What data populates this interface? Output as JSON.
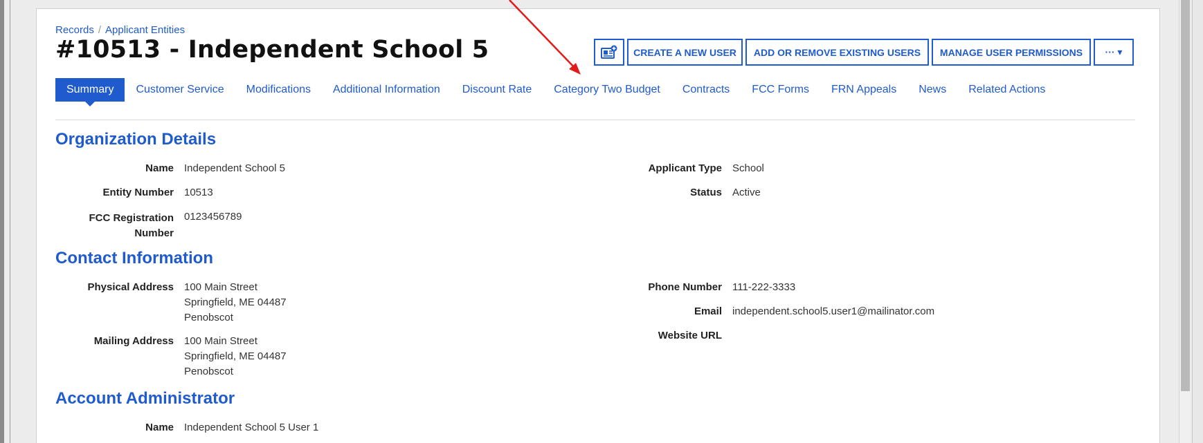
{
  "breadcrumb": {
    "root": "Records",
    "current": "Applicant Entities"
  },
  "page_title": "#10513 - Independent School 5",
  "toolbar": {
    "icon_button": "contact-card-add-icon",
    "create_user": "CREATE A NEW USER",
    "add_remove_users": "ADD OR REMOVE EXISTING USERS",
    "manage_permissions": "MANAGE USER PERMISSIONS",
    "more": "··· ▾"
  },
  "tabs": [
    {
      "label": "Summary",
      "active": true
    },
    {
      "label": "Customer Service"
    },
    {
      "label": "Modifications"
    },
    {
      "label": "Additional Information"
    },
    {
      "label": "Discount Rate"
    },
    {
      "label": "Category Two Budget"
    },
    {
      "label": "Contracts"
    },
    {
      "label": "FCC Forms"
    },
    {
      "label": "FRN Appeals"
    },
    {
      "label": "News"
    },
    {
      "label": "Related Actions"
    }
  ],
  "organization": {
    "title": "Organization Details",
    "name_label": "Name",
    "name": "Independent School 5",
    "entity_label": "Entity Number",
    "entity": "10513",
    "fcc_label_1": "FCC Registration",
    "fcc_label_2": "Number",
    "fcc": "0123456789",
    "type_label": "Applicant Type",
    "type": "School",
    "status_label": "Status",
    "status": "Active"
  },
  "contact": {
    "title": "Contact Information",
    "physical_label": "Physical Address",
    "physical": [
      "100 Main Street",
      "Springfield, ME 04487",
      "Penobscot"
    ],
    "mailing_label": "Mailing Address",
    "mailing": [
      "100 Main Street",
      "Springfield, ME 04487",
      "Penobscot"
    ],
    "phone_label": "Phone Number",
    "phone": "111-222-3333",
    "email_label": "Email",
    "email": "independent.school5.user1@mailinator.com",
    "website_label": "Website URL"
  },
  "admin": {
    "title": "Account Administrator",
    "name_label": "Name",
    "name": "Independent School 5 User 1"
  },
  "colors": {
    "accent": "#1f5bcc",
    "annotation_arrow": "#e11a1a"
  }
}
